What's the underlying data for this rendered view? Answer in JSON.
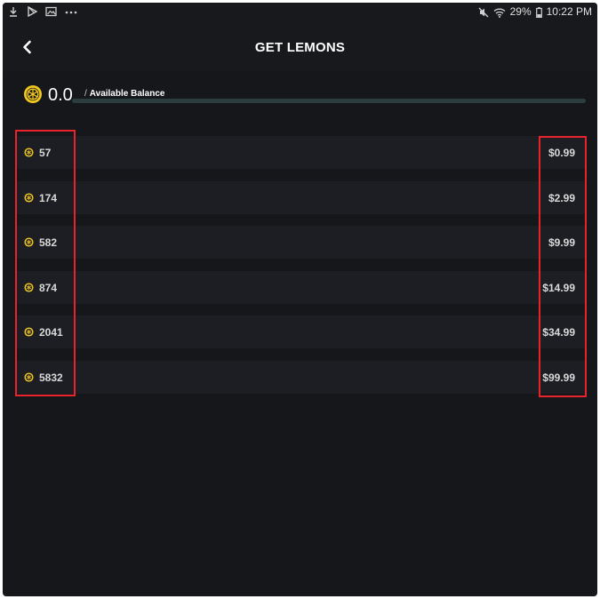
{
  "status_bar": {
    "icons_left": [
      "download-icon",
      "play-store-icon",
      "image-icon",
      "more-icon"
    ],
    "battery": "29%",
    "time": "10:22 PM"
  },
  "header": {
    "title": "GET LEMONS",
    "back_icon": "chevron-left-icon"
  },
  "balance": {
    "value": "0.0",
    "separator": "/",
    "label": "Available Balance"
  },
  "packages": [
    {
      "amount": "57",
      "price": "$0.99"
    },
    {
      "amount": "174",
      "price": "$2.99"
    },
    {
      "amount": "582",
      "price": "$9.99"
    },
    {
      "amount": "874",
      "price": "$14.99"
    },
    {
      "amount": "2041",
      "price": "$34.99"
    },
    {
      "amount": "5832",
      "price": "$99.99"
    }
  ],
  "colors": {
    "background": "#15171b",
    "row": "#1c1e23",
    "coin": "#f2c81e",
    "highlight": "#e8232a",
    "balance_bar": "#2c3d40"
  }
}
